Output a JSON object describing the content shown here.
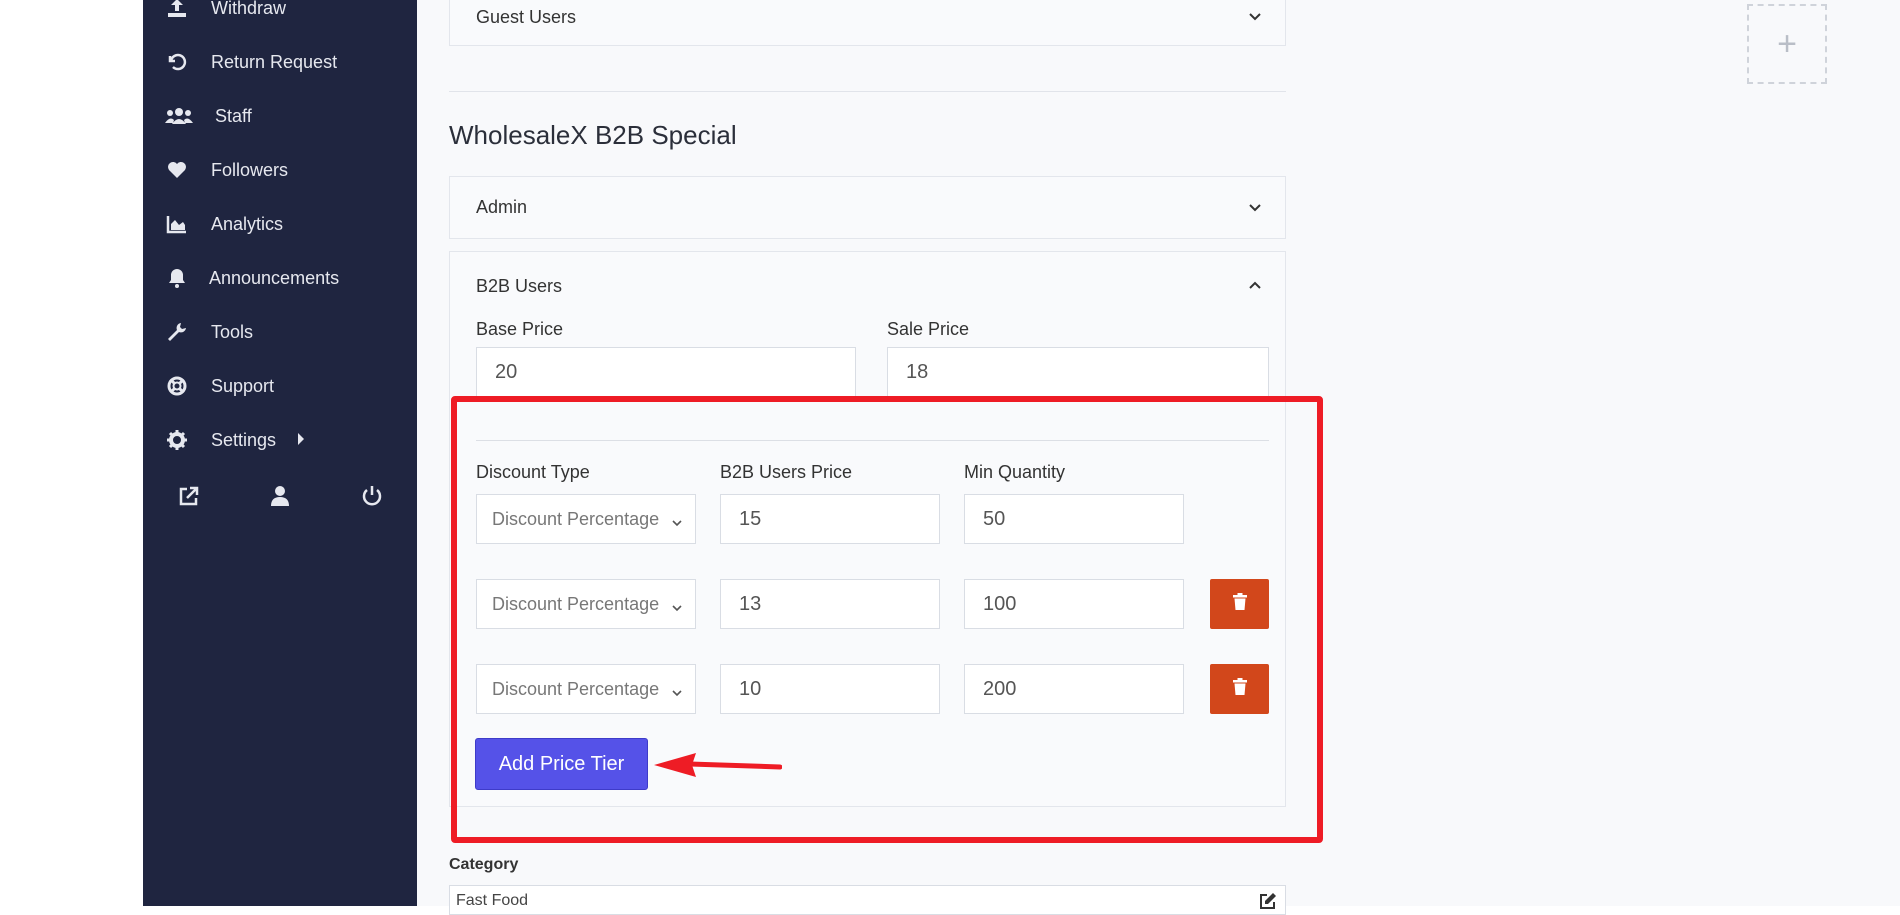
{
  "sidebar": {
    "items": [
      {
        "label": "Withdraw",
        "icon": "upload-icon"
      },
      {
        "label": "Return Request",
        "icon": "undo-icon"
      },
      {
        "label": "Staff",
        "icon": "users-icon"
      },
      {
        "label": "Followers",
        "icon": "heart-icon"
      },
      {
        "label": "Analytics",
        "icon": "chart-area-icon"
      },
      {
        "label": "Announcements",
        "icon": "bell-icon"
      },
      {
        "label": "Tools",
        "icon": "wrench-icon"
      },
      {
        "label": "Support",
        "icon": "life-ring-icon"
      },
      {
        "label": "Settings",
        "icon": "gear-icon"
      }
    ],
    "footer_icons": [
      "external-link-icon",
      "user-icon",
      "power-icon"
    ]
  },
  "guest_users": {
    "title": "Guest Users"
  },
  "section_title": "WholesaleX B2B Special",
  "admin": {
    "title": "Admin"
  },
  "b2b": {
    "title": "B2B Users",
    "base_price_label": "Base Price",
    "base_price": "20",
    "sale_price_label": "Sale Price",
    "sale_price": "18",
    "col_discount_type": "Discount Type",
    "col_price": "B2B Users Price",
    "col_min_qty": "Min Quantity",
    "tiers": [
      {
        "type": "Discount Percentage",
        "price": "15",
        "qty": "50"
      },
      {
        "type": "Discount Percentage",
        "price": "13",
        "qty": "100"
      },
      {
        "type": "Discount Percentage",
        "price": "10",
        "qty": "200"
      }
    ],
    "add_tier_label": "Add Price Tier"
  },
  "category": {
    "label": "Category",
    "value": "Fast Food"
  },
  "colors": {
    "sidebar": "#1f2540",
    "accent": "#5552e8",
    "danger": "#d2471b",
    "highlight": "#ee1c25"
  }
}
